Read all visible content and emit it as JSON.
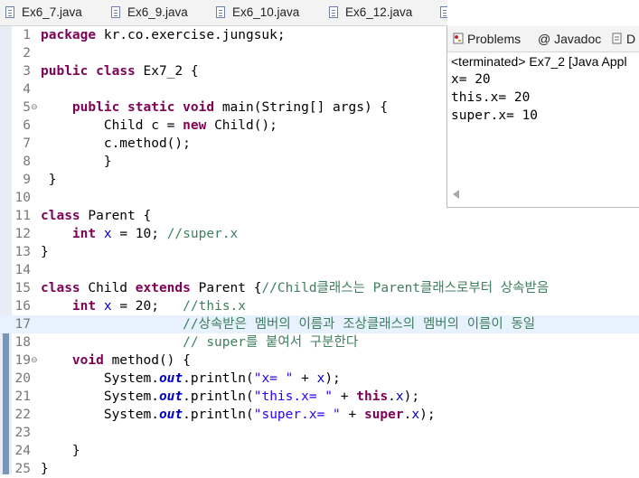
{
  "editor_tabs": [
    {
      "label": "Ex6_7.java"
    },
    {
      "label": "Ex6_9.java"
    },
    {
      "label": "Ex6_10.java"
    },
    {
      "label": "Ex6_12.java"
    }
  ],
  "console_view": {
    "tabs": [
      {
        "label": "Problems",
        "icon": "problems-icon"
      },
      {
        "label": "@ Javadoc",
        "icon": "javadoc-icon"
      },
      {
        "label": "D",
        "icon": "declaration-icon"
      }
    ],
    "status": "<terminated> Ex7_2 [Java Appl",
    "output": [
      "x= 20",
      "this.x= 20",
      "super.x= 10"
    ]
  },
  "code": {
    "line_numbers": [
      "1",
      "2",
      "3",
      "4",
      "5",
      "6",
      "7",
      "8",
      "9",
      "10",
      "11",
      "12",
      "13",
      "14",
      "15",
      "16",
      "17",
      "18",
      "19",
      "20",
      "21",
      "22",
      "23",
      "24",
      "25"
    ],
    "lines": [
      "package kr.co.exercise.jungsuk;",
      "",
      "public class Ex7_2 {",
      "",
      "    public static void main(String[] args) {",
      "        Child c = new Child();",
      "        c.method();",
      "        }",
      " }",
      "",
      "class Parent {",
      "    int x = 10; //super.x",
      "}",
      "",
      "class Child extends Parent {//Child클래스는 Parent클래스로부터 상속받음",
      "    int x = 20;   //this.x",
      "                  //상속받은 멤버의 이름과 조상클래스의 멤버의 이름이 동일",
      "                  // super를 붙여서 구분한다",
      "    void method() {",
      "        System.out.println(\"x= \" + x);",
      "        System.out.println(\"this.x= \" + this.x);",
      "        System.out.println(\"super.x= \" + super.x);",
      "",
      "    }",
      "}"
    ],
    "fold_markers": [
      {
        "line": 5,
        "symbol": "⊖"
      },
      {
        "line": 19,
        "symbol": "⊖"
      }
    ],
    "current_line": 17
  },
  "colors": {
    "keyword": "#7f0055",
    "comment": "#3f7f5f",
    "string": "#2a00ff",
    "field": "#0000c0",
    "current_line_bg": "#e8f2fe"
  }
}
